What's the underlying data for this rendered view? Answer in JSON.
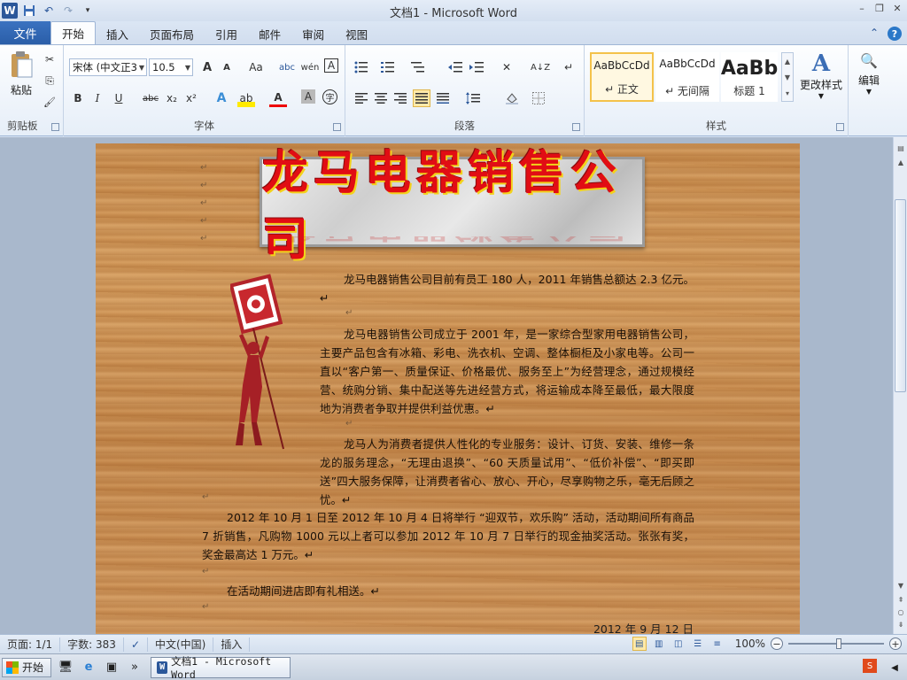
{
  "window": {
    "title": "文档1  -  Microsoft Word",
    "minimize": "–",
    "restore": "❐",
    "close": "✕"
  },
  "qat": {
    "app_icon": "W",
    "save_icon": "💾",
    "undo_icon": "↶",
    "redo_icon": "↷",
    "customize_icon": "▾"
  },
  "tabs": {
    "file": "文件",
    "items": [
      "开始",
      "插入",
      "页面布局",
      "引用",
      "邮件",
      "审阅",
      "视图"
    ],
    "active": "开始",
    "collapse_icon": "⌃",
    "help_icon": "?"
  },
  "ribbon": {
    "clipboard": {
      "label": "剪贴板",
      "paste": "粘贴",
      "cut_icon": "✂",
      "copy_icon": "⎘",
      "format_painter_icon": "🖌"
    },
    "font": {
      "label": "字体",
      "font_name": "宋体 (中文正3",
      "font_size": "10.5",
      "grow": "A",
      "shrink": "A",
      "change_case": "Aa",
      "clear_format": "abc",
      "pinyin": "wén",
      "char_border": "A",
      "bold": "B",
      "italic": "I",
      "underline": "U",
      "strike": "abc",
      "subscript": "x₂",
      "superscript": "x²",
      "text_effects": "A",
      "highlight": "ab",
      "font_color": "A",
      "char_shading": "A",
      "enclose": "字"
    },
    "paragraph": {
      "label": "段落"
    },
    "styles": {
      "label": "样式",
      "items": [
        {
          "sample": "AaBbCcDd",
          "name": "↵ 正文"
        },
        {
          "sample": "AaBbCcDd",
          "name": "↵ 无间隔"
        },
        {
          "sample": "AaBb",
          "name": "标题 1"
        }
      ],
      "change_styles": "更改样式",
      "change_styles_icon": "A"
    },
    "editing": {
      "label": "编辑",
      "icon": "🔍"
    }
  },
  "document": {
    "banner": "龙马电器销售公司",
    "paragraphs": [
      "龙马电器销售公司目前有员工 180 人，2011 年销售总额达 2.3 亿元。↵",
      "龙马电器销售公司成立于 2001 年，是一家综合型家用电器销售公司，主要产品包含有冰箱、彩电、洗衣机、空调、整体橱柜及小家电等。公司一直以“客户第一、质量保证、价格最优、服务至上”为经营理念，通过规模经营、统购分销、集中配送等先进经营方式，将运输成本降至最低，最大限度地为消费者争取并提供利益优惠。↵",
      "龙马人为消费者提供人性化的专业服务：设计、订货、安装、维修一条龙的服务理念，“无理由退换”、“60 天质量试用”、“低价补偿”、“即买即送”四大服务保障，让消费者省心、放心、开心，尽享购物之乐，毫无后顾之忧。↵",
      "2012 年 10 月 1 日至 2012 年 10 月 4 日将举行 “迎双节，欢乐购” 活动，活动期间所有商品 7 折销售，凡购物 1000 元以上者可以参加 2012 年 10 月 7 日举行的现金抽奖活动。张张有奖，奖金最高达 1 万元。↵",
      "在活动期间进店即有礼相送。↵"
    ],
    "date": "2012 年 9 月 12 日"
  },
  "statusbar": {
    "page": "页面: 1/1",
    "words": "字数: 383",
    "language": "中文(中国)",
    "mode": "插入",
    "zoom": "100%"
  },
  "taskbar": {
    "start": "开始",
    "task": "文档1 - Microsoft Word",
    "more": "»"
  },
  "colors": {
    "accent": "#2b579a",
    "banner_text": "#e10d14"
  }
}
